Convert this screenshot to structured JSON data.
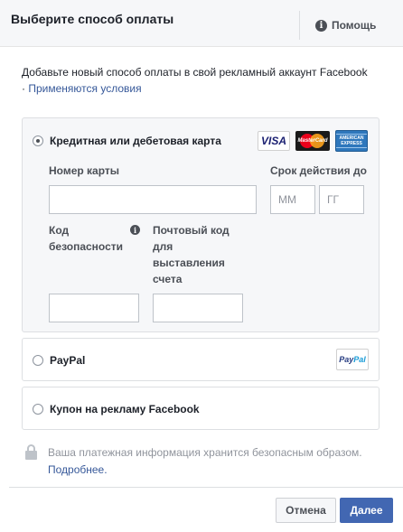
{
  "header": {
    "title": "Выберите способ оплаты",
    "help_label": "Помощь"
  },
  "intro": {
    "text": "Добавьте новый способ оплаты в свой рекламный аккаунт Facebook",
    "bullet": "·",
    "terms_link": "Применяются условия"
  },
  "card_option": {
    "label": "Кредитная или дебетовая карта",
    "selected": true,
    "logos": {
      "visa": "VISA",
      "mastercard": "MasterCard",
      "amex_line1": "AMERICAN",
      "amex_line2": "EXPRESS"
    },
    "card_number_label": "Номер карты",
    "card_number_value": "",
    "expiry_label": "Срок действия до",
    "expiry_month_placeholder": "ММ",
    "expiry_year_placeholder": "ГГ",
    "security_code_label_line1": "Код",
    "security_code_label_line2": "безопасности",
    "security_code_value": "",
    "postal_code_label_line1": "Почтовый код",
    "postal_code_label_line2": "для",
    "postal_code_label_line3": "выставления",
    "postal_code_label_line4": "счета",
    "postal_code_value": ""
  },
  "paypal_option": {
    "label": "PayPal",
    "selected": false,
    "logo_part1": "Pay",
    "logo_part2": "Pal"
  },
  "coupon_option": {
    "label": "Купон на рекламу Facebook",
    "selected": false
  },
  "secure_note": {
    "text": "Ваша платежная информация хранится безопасным образом.",
    "more_link": "Подробнее."
  },
  "footer": {
    "cancel_label": "Отмена",
    "next_label": "Далее"
  },
  "icons": {
    "help": "info-icon",
    "security_code_info": "info-icon",
    "secure": "lock-icon"
  },
  "colors": {
    "primary_button": "#4267b2",
    "link": "#365899",
    "header_bg": "#f6f7f9"
  }
}
